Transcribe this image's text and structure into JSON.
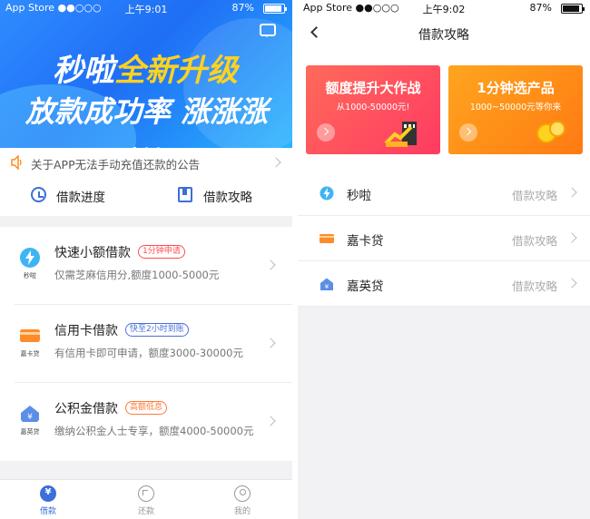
{
  "left": {
    "status_bar": {
      "carrier": "App Store ●●○○○",
      "time": "上午9:01",
      "battery": "87%"
    },
    "banner": {
      "line1_white": "秒啦",
      "line1_yellow": "全新升级",
      "line2": "放款成功率 涨涨涨",
      "page_count": 3,
      "active_page": 1
    },
    "notice": {
      "text": "关于APP无法手动充值还款的公告"
    },
    "quick_actions": [
      {
        "label": "借款进度",
        "icon": "clock-icon"
      },
      {
        "label": "借款攻略",
        "icon": "book-icon"
      }
    ],
    "loans": [
      {
        "title": "快速小额借款",
        "tag": "1分钟申请",
        "tag_color": "#ff4d4f",
        "desc": "仅需芝麻信用分,额度1000-5000元",
        "logo_label": "秒啦",
        "logo_color": "#3fb4f5"
      },
      {
        "title": "信用卡借款",
        "tag": "快至2小时到账",
        "tag_color": "#4a6fd8",
        "desc": "有信用卡即可申请，额度3000-30000元",
        "logo_label": "嘉卡贷",
        "logo_color": "#ff8a2a"
      },
      {
        "title": "公积金借款",
        "tag": "高额低息",
        "tag_color": "#ff7a3a",
        "desc": "缴纳公积金人士专享，额度4000-50000元",
        "logo_label": "嘉英贷",
        "logo_color": "#5b8ee6"
      }
    ],
    "tabs": [
      {
        "label": "借款",
        "icon": "yen-icon",
        "active": true
      },
      {
        "label": "还款",
        "icon": "repay-icon",
        "active": false
      },
      {
        "label": "我的",
        "icon": "user-icon",
        "active": false
      }
    ]
  },
  "right": {
    "status_bar": {
      "carrier": "App Store ●●○○○",
      "time": "上午9:02",
      "battery": "87%"
    },
    "nav_title": "借款攻略",
    "cards": [
      {
        "title": "额度提升大作战",
        "subtitle": "从1000-50000元!",
        "color": "#ff4d5e"
      },
      {
        "title": "1分钟选产品",
        "subtitle": "1000~50000元等你来",
        "color": "#ff8f1a"
      }
    ],
    "guides": [
      {
        "name": "秒啦",
        "action": "借款攻略",
        "icon": "lightning-icon"
      },
      {
        "name": "嘉卡贷",
        "action": "借款攻略",
        "icon": "card-icon"
      },
      {
        "name": "嘉英贷",
        "action": "借款攻略",
        "icon": "house-icon"
      }
    ]
  }
}
